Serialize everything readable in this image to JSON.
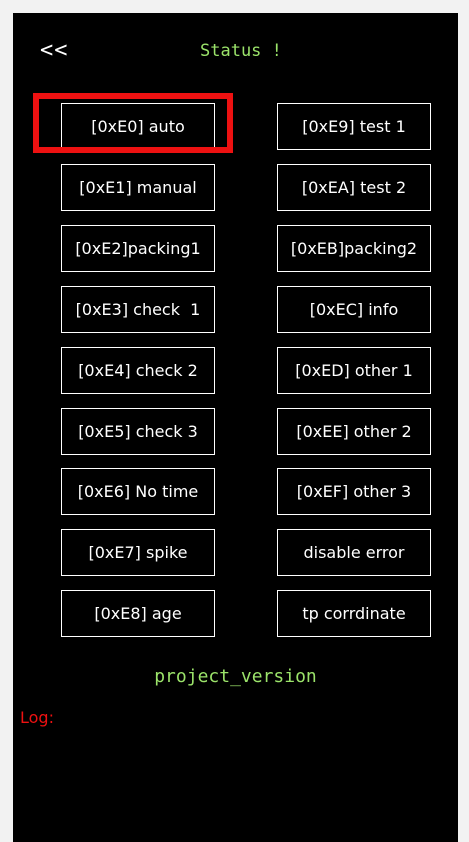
{
  "header": {
    "back_label": "<<",
    "title": "Status !"
  },
  "buttons_left": [
    {
      "label": "[0xE0] auto",
      "highlighted": true
    },
    {
      "label": "[0xE1] manual"
    },
    {
      "label": "[0xE2]packing1"
    },
    {
      "label": "[0xE3] check  1"
    },
    {
      "label": "[0xE4] check 2"
    },
    {
      "label": "[0xE5] check 3"
    },
    {
      "label": "[0xE6] No time"
    },
    {
      "label": "[0xE7] spike"
    },
    {
      "label": "[0xE8] age"
    }
  ],
  "buttons_right": [
    {
      "label": "[0xE9] test 1"
    },
    {
      "label": "[0xEA] test 2"
    },
    {
      "label": "[0xEB]packing2"
    },
    {
      "label": "[0xEC] info"
    },
    {
      "label": "[0xED] other 1"
    },
    {
      "label": "[0xEE] other 2"
    },
    {
      "label": "[0xEF] other 3"
    },
    {
      "label": "disable error"
    },
    {
      "label": "tp corrdinate"
    }
  ],
  "footer": {
    "version_label": "project_version",
    "log_label": "Log:"
  },
  "colors": {
    "background": "#000000",
    "title_green": "#9be36a",
    "log_red": "#ee1111",
    "highlight_red": "#ee1111",
    "button_border": "#ffffff"
  }
}
